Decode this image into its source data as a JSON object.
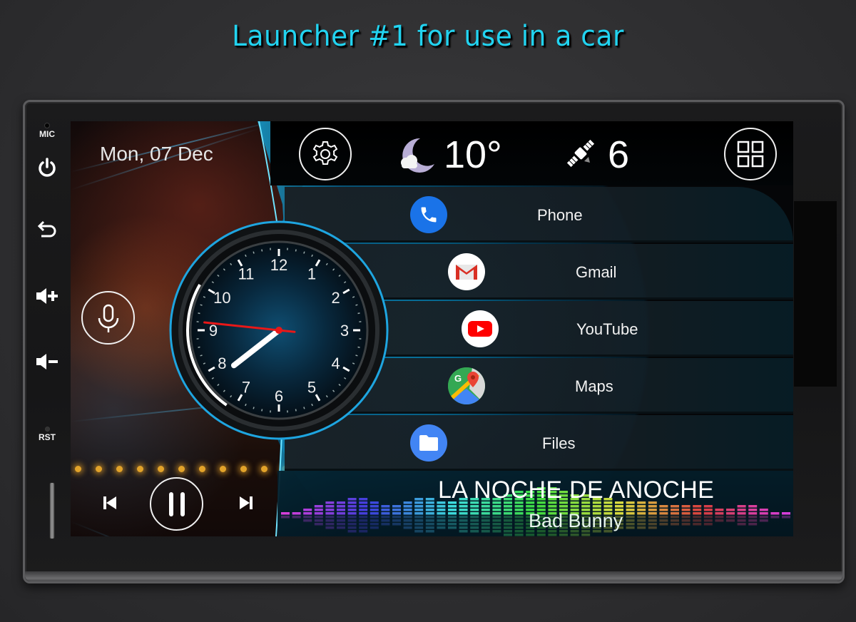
{
  "headline": "Launcher #1 for use in a car",
  "hardware_buttons": {
    "mic_label": "MIC",
    "rst_label": "RST",
    "icons": [
      "power-icon",
      "back-icon",
      "volume-up-icon",
      "volume-down-icon"
    ]
  },
  "status_bar": {
    "date": "Mon, 07 Dec",
    "settings_icon": "gear-icon",
    "weather_icon": "moon-cloud-icon",
    "temperature": "10°",
    "gps_icon": "satellite-icon",
    "satellite_count": "6",
    "apps_icon": "grid-icon"
  },
  "clock": {
    "hour": 7,
    "minute": 40,
    "second": 46,
    "numbers": [
      "12",
      "1",
      "2",
      "3",
      "4",
      "5",
      "6",
      "7",
      "8",
      "9",
      "10",
      "11"
    ],
    "accent_color": "#e81818",
    "ring_color": "#1ea5e0"
  },
  "voice_button": {
    "icon": "microphone-icon"
  },
  "apps": [
    {
      "label": "Phone",
      "icon": "phone-icon",
      "color": "#1a73e8"
    },
    {
      "label": "Gmail",
      "icon": "gmail-icon",
      "color": "#d93025"
    },
    {
      "label": "YouTube",
      "icon": "youtube-icon",
      "color": "#ff0000"
    },
    {
      "label": "Maps",
      "icon": "maps-icon",
      "color": "#34a853"
    },
    {
      "label": "Files",
      "icon": "folder-icon",
      "color": "#4285f4"
    }
  ],
  "player": {
    "title": "LA NOCHE DE ANOCHE",
    "artist": "Bad Bunny",
    "prev_icon": "skip-previous-icon",
    "pause_icon": "pause-icon",
    "next_icon": "skip-next-icon",
    "state": "playing"
  }
}
